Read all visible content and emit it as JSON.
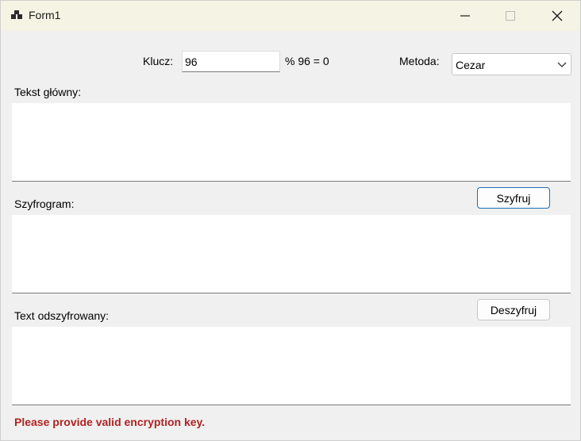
{
  "window": {
    "title": "Form1"
  },
  "key": {
    "label": "Klucz:",
    "value": "96",
    "modulo_text": "% 96 = 0"
  },
  "method": {
    "label": "Metoda:",
    "selected": "Cezar"
  },
  "sections": {
    "plain_label": "Tekst główny:",
    "cipher_label": "Szyfrogram:",
    "decrypted_label": "Text odszyfrowany:"
  },
  "buttons": {
    "encrypt": "Szyfruj",
    "decrypt": "Deszyfruj"
  },
  "status": {
    "message": "Please provide valid encryption key.",
    "color": "#b22222"
  },
  "icons": {
    "app": "app-icon",
    "minimize": "minimize-icon",
    "maximize": "maximize-icon",
    "close": "close-icon",
    "dropdown": "chevron-down-icon"
  }
}
